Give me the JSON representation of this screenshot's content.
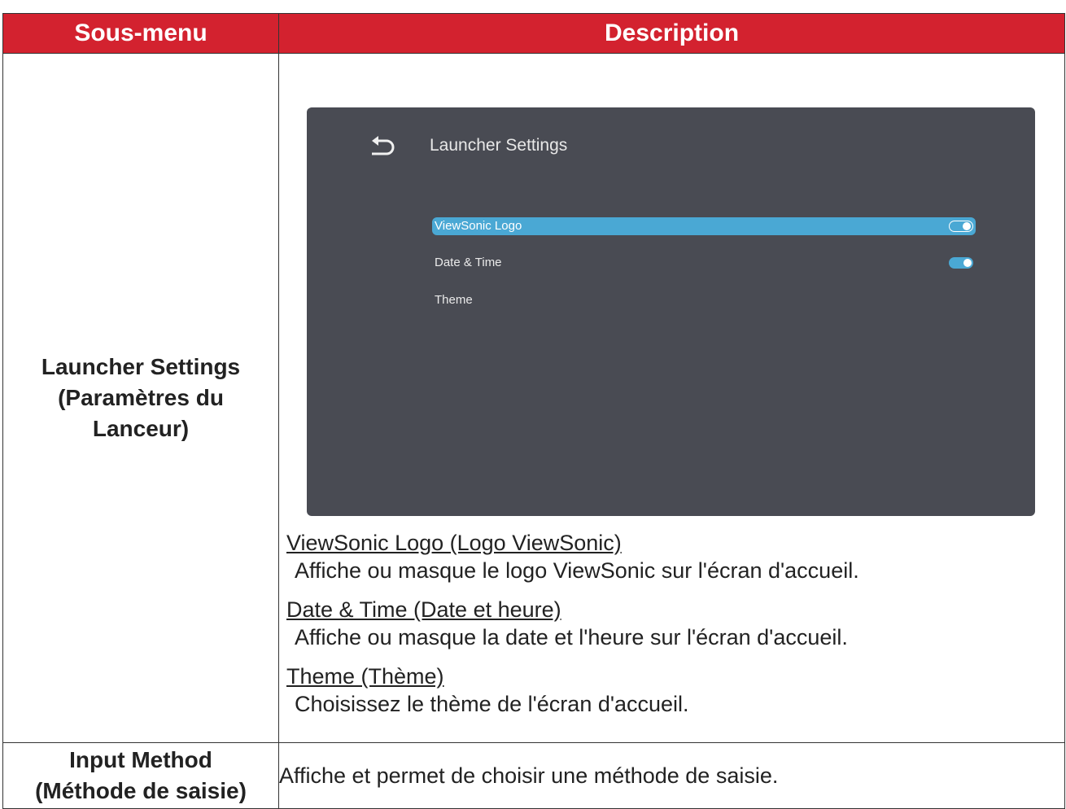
{
  "table": {
    "header_left": "Sous-menu",
    "header_right": "Description"
  },
  "launcher": {
    "label_line1": "Launcher Settings",
    "label_line2": "(Paramètres du",
    "label_line3": "Lanceur)",
    "screenshot": {
      "title": "Launcher Settings",
      "back_icon": "back-arrow-icon",
      "items": [
        {
          "label": "ViewSonic Logo",
          "selected": true,
          "toggle": "on"
        },
        {
          "label": "Date & Time",
          "selected": false,
          "toggle": "on"
        },
        {
          "label": "Theme",
          "selected": false,
          "toggle": null
        }
      ],
      "accent_color": "#4aa8d4",
      "background_color": "#494b53"
    },
    "descriptions": [
      {
        "term": "ViewSonic Logo (Logo ViewSonic)",
        "text": "Affiche ou masque le logo ViewSonic sur l'écran d'accueil."
      },
      {
        "term": "Date & Time (Date et heure)",
        "text": "Affiche ou masque la date et l'heure sur l'écran d'accueil."
      },
      {
        "term": "Theme (Thème)",
        "text": "Choisissez le thème de l'écran d'accueil."
      }
    ]
  },
  "input_method": {
    "label_line1": "Input Method",
    "label_line2": "(Méthode de saisie)",
    "description": "Affiche et permet de choisir une méthode de saisie."
  },
  "colors": {
    "header_bg": "#d3222f",
    "header_text": "#ffffff"
  }
}
